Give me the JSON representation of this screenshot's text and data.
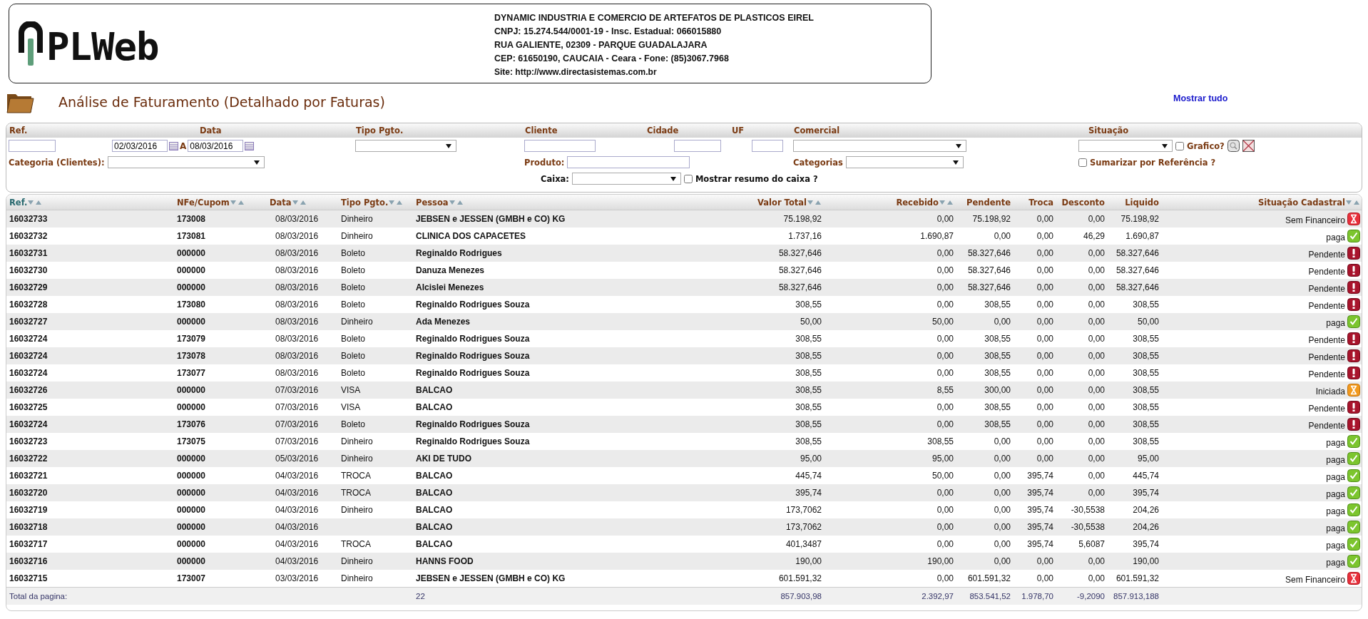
{
  "header": {
    "logo_text": "PLWeb",
    "company": [
      "DYNAMIC INDUSTRIA E COMERCIO DE ARTEFATOS DE PLASTICOS EIREL",
      "CNPJ: 15.274.544/0001-19 - Insc. Estadual: 066015880",
      "RUA GALIENTE, 02309 - PARQUE GUADALAJARA",
      "CEP: 61650190, CAUCAIA - Ceara - Fone: (85)3067.7968",
      "Site: http://www.directasistemas.com.br"
    ]
  },
  "page": {
    "title": "Análise de Faturamento (Detalhado por Faturas)",
    "show_all_link": "Mostrar tudo"
  },
  "filters": {
    "labels": [
      "Ref.",
      "Data",
      "Tipo Pgto.",
      "Cliente",
      "Cidade",
      "UF",
      "Comercial",
      "Situação"
    ],
    "date_from": "02/03/2016",
    "date_separator": "A",
    "date_to": "08/03/2016",
    "grafico": {
      "label": "Grafico?",
      "checked": false
    },
    "categoria_label": "Categoria (Clientes):",
    "produto_label": "Produto:",
    "categorias_label": "Categorias",
    "sumarizar": {
      "label": "Sumarizar por Referência ?",
      "checked": false
    },
    "caixa_label": "Caixa:",
    "resumo_caixa": {
      "label": "Mostrar resumo do caixa ?",
      "checked": false
    }
  },
  "table": {
    "columns": [
      {
        "label": "Ref.",
        "sortable": true,
        "selected": true
      },
      {
        "label": "NFe/Cupom",
        "sortable": true,
        "selected": false
      },
      {
        "label": "Data",
        "sortable": true,
        "selected": false
      },
      {
        "label": "Tipo Pgto.",
        "sortable": true,
        "selected": false
      },
      {
        "label": "Pessoa",
        "sortable": true,
        "selected": false
      },
      {
        "label": "Valor Total",
        "sortable": true,
        "selected": false
      },
      {
        "label": "Recebido",
        "sortable": true,
        "selected": false
      },
      {
        "label": "Pendente",
        "sortable": false,
        "selected": false
      },
      {
        "label": "Troca",
        "sortable": false,
        "selected": false
      },
      {
        "label": "Desconto",
        "sortable": false,
        "selected": false
      },
      {
        "label": "Liquido",
        "sortable": false,
        "selected": false
      },
      {
        "label": "Situação Cadastral",
        "sortable": true,
        "selected": false
      }
    ],
    "rows": [
      {
        "ref": "16032733",
        "nfe": "173008",
        "data": "08/03/2016",
        "tipo": "Dinheiro",
        "pessoa": "JEBSEN e JESSEN (GMBH e CO) KG",
        "valor_total": "75.198,92",
        "recebido": "0,00",
        "pendente": "75.198,92",
        "troca": "0,00",
        "desconto": "0,00",
        "liquido": "75.198,92",
        "situacao": "Sem Financeiro",
        "kind": "sem-financeiro"
      },
      {
        "ref": "16032732",
        "nfe": "173081",
        "data": "08/03/2016",
        "tipo": "Dinheiro",
        "pessoa": "CLINICA DOS CAPACETES",
        "valor_total": "1.737,16",
        "recebido": "1.690,87",
        "pendente": "0,00",
        "troca": "0,00",
        "desconto": "46,29",
        "liquido": "1.690,87",
        "situacao": "paga",
        "kind": "paga"
      },
      {
        "ref": "16032731",
        "nfe": "000000",
        "data": "08/03/2016",
        "tipo": "Boleto",
        "pessoa": "Reginaldo Rodrigues",
        "valor_total": "58.327,646",
        "recebido": "0,00",
        "pendente": "58.327,646",
        "troca": "0,00",
        "desconto": "0,00",
        "liquido": "58.327,646",
        "situacao": "Pendente",
        "kind": "pendente"
      },
      {
        "ref": "16032730",
        "nfe": "000000",
        "data": "08/03/2016",
        "tipo": "Boleto",
        "pessoa": "Danuza Menezes",
        "valor_total": "58.327,646",
        "recebido": "0,00",
        "pendente": "58.327,646",
        "troca": "0,00",
        "desconto": "0,00",
        "liquido": "58.327,646",
        "situacao": "Pendente",
        "kind": "pendente"
      },
      {
        "ref": "16032729",
        "nfe": "000000",
        "data": "08/03/2016",
        "tipo": "Boleto",
        "pessoa": "Alcislei Menezes",
        "valor_total": "58.327,646",
        "recebido": "0,00",
        "pendente": "58.327,646",
        "troca": "0,00",
        "desconto": "0,00",
        "liquido": "58.327,646",
        "situacao": "Pendente",
        "kind": "pendente"
      },
      {
        "ref": "16032728",
        "nfe": "173080",
        "data": "08/03/2016",
        "tipo": "Boleto",
        "pessoa": "Reginaldo Rodrigues Souza",
        "valor_total": "308,55",
        "recebido": "0,00",
        "pendente": "308,55",
        "troca": "0,00",
        "desconto": "0,00",
        "liquido": "308,55",
        "situacao": "Pendente",
        "kind": "pendente"
      },
      {
        "ref": "16032727",
        "nfe": "000000",
        "data": "08/03/2016",
        "tipo": "Dinheiro",
        "pessoa": "Ada Menezes",
        "valor_total": "50,00",
        "recebido": "50,00",
        "pendente": "0,00",
        "troca": "0,00",
        "desconto": "0,00",
        "liquido": "50,00",
        "situacao": "paga",
        "kind": "paga"
      },
      {
        "ref": "16032724",
        "nfe": "173079",
        "data": "08/03/2016",
        "tipo": "Boleto",
        "pessoa": "Reginaldo Rodrigues Souza",
        "valor_total": "308,55",
        "recebido": "0,00",
        "pendente": "308,55",
        "troca": "0,00",
        "desconto": "0,00",
        "liquido": "308,55",
        "situacao": "Pendente",
        "kind": "pendente"
      },
      {
        "ref": "16032724",
        "nfe": "173078",
        "data": "08/03/2016",
        "tipo": "Boleto",
        "pessoa": "Reginaldo Rodrigues Souza",
        "valor_total": "308,55",
        "recebido": "0,00",
        "pendente": "308,55",
        "troca": "0,00",
        "desconto": "0,00",
        "liquido": "308,55",
        "situacao": "Pendente",
        "kind": "pendente"
      },
      {
        "ref": "16032724",
        "nfe": "173077",
        "data": "08/03/2016",
        "tipo": "Boleto",
        "pessoa": "Reginaldo Rodrigues Souza",
        "valor_total": "308,55",
        "recebido": "0,00",
        "pendente": "308,55",
        "troca": "0,00",
        "desconto": "0,00",
        "liquido": "308,55",
        "situacao": "Pendente",
        "kind": "pendente"
      },
      {
        "ref": "16032726",
        "nfe": "000000",
        "data": "07/03/2016",
        "tipo": "VISA",
        "pessoa": "BALCAO",
        "valor_total": "308,55",
        "recebido": "8,55",
        "pendente": "300,00",
        "troca": "0,00",
        "desconto": "0,00",
        "liquido": "308,55",
        "situacao": "Iniciada",
        "kind": "iniciada"
      },
      {
        "ref": "16032725",
        "nfe": "000000",
        "data": "07/03/2016",
        "tipo": "VISA",
        "pessoa": "BALCAO",
        "valor_total": "308,55",
        "recebido": "0,00",
        "pendente": "308,55",
        "troca": "0,00",
        "desconto": "0,00",
        "liquido": "308,55",
        "situacao": "Pendente",
        "kind": "pendente"
      },
      {
        "ref": "16032724",
        "nfe": "173076",
        "data": "07/03/2016",
        "tipo": "Boleto",
        "pessoa": "Reginaldo Rodrigues Souza",
        "valor_total": "308,55",
        "recebido": "0,00",
        "pendente": "308,55",
        "troca": "0,00",
        "desconto": "0,00",
        "liquido": "308,55",
        "situacao": "Pendente",
        "kind": "pendente"
      },
      {
        "ref": "16032723",
        "nfe": "173075",
        "data": "07/03/2016",
        "tipo": "Dinheiro",
        "pessoa": "Reginaldo Rodrigues Souza",
        "valor_total": "308,55",
        "recebido": "308,55",
        "pendente": "0,00",
        "troca": "0,00",
        "desconto": "0,00",
        "liquido": "308,55",
        "situacao": "paga",
        "kind": "paga"
      },
      {
        "ref": "16032722",
        "nfe": "000000",
        "data": "05/03/2016",
        "tipo": "Dinheiro",
        "pessoa": "AKI DE TUDO",
        "valor_total": "95,00",
        "recebido": "95,00",
        "pendente": "0,00",
        "troca": "0,00",
        "desconto": "0,00",
        "liquido": "95,00",
        "situacao": "paga",
        "kind": "paga"
      },
      {
        "ref": "16032721",
        "nfe": "000000",
        "data": "04/03/2016",
        "tipo": "TROCA",
        "pessoa": "BALCAO",
        "valor_total": "445,74",
        "recebido": "50,00",
        "pendente": "0,00",
        "troca": "395,74",
        "desconto": "0,00",
        "liquido": "445,74",
        "situacao": "paga",
        "kind": "paga"
      },
      {
        "ref": "16032720",
        "nfe": "000000",
        "data": "04/03/2016",
        "tipo": "TROCA",
        "pessoa": "BALCAO",
        "valor_total": "395,74",
        "recebido": "0,00",
        "pendente": "0,00",
        "troca": "395,74",
        "desconto": "0,00",
        "liquido": "395,74",
        "situacao": "paga",
        "kind": "paga"
      },
      {
        "ref": "16032719",
        "nfe": "000000",
        "data": "04/03/2016",
        "tipo": "Dinheiro",
        "pessoa": "BALCAO",
        "valor_total": "173,7062",
        "recebido": "0,00",
        "pendente": "0,00",
        "troca": "395,74",
        "desconto": "-30,5538",
        "liquido": "204,26",
        "situacao": "paga",
        "kind": "paga"
      },
      {
        "ref": "16032718",
        "nfe": "000000",
        "data": "04/03/2016",
        "pessoa": "BALCAO",
        "valor_total": "173,7062",
        "recebido": "0,00",
        "pendente": "0,00",
        "troca": "395,74",
        "desconto": "-30,5538",
        "liquido": "204,26",
        "situacao": "paga",
        "kind": "paga"
      },
      {
        "ref": "16032717",
        "nfe": "000000",
        "data": "04/03/2016",
        "tipo": "TROCA",
        "pessoa": "BALCAO",
        "valor_total": "401,3487",
        "recebido": "0,00",
        "pendente": "0,00",
        "troca": "395,74",
        "desconto": "5,6087",
        "liquido": "395,74",
        "situacao": "paga",
        "kind": "paga"
      },
      {
        "ref": "16032716",
        "nfe": "000000",
        "data": "04/03/2016",
        "tipo": "Dinheiro",
        "pessoa": "HANNS FOOD",
        "valor_total": "190,00",
        "recebido": "190,00",
        "pendente": "0,00",
        "troca": "0,00",
        "desconto": "0,00",
        "liquido": "190,00",
        "situacao": "paga",
        "kind": "paga"
      },
      {
        "ref": "16032715",
        "nfe": "173007",
        "data": "03/03/2016",
        "tipo": "Dinheiro",
        "pessoa": "JEBSEN e JESSEN (GMBH e CO) KG",
        "valor_total": "601.591,32",
        "recebido": "0,00",
        "pendente": "601.591,32",
        "troca": "0,00",
        "desconto": "0,00",
        "liquido": "601.591,32",
        "situacao": "Sem Financeiro",
        "kind": "sem-financeiro"
      }
    ],
    "totals": {
      "label": "Total da pagina:",
      "count": "22",
      "valor_total": "857.903,98",
      "recebido": "2.392,97",
      "pendente": "853.541,52",
      "troca": "1.978,70",
      "desconto": "-9,2090",
      "liquido": "857.913,188"
    }
  }
}
